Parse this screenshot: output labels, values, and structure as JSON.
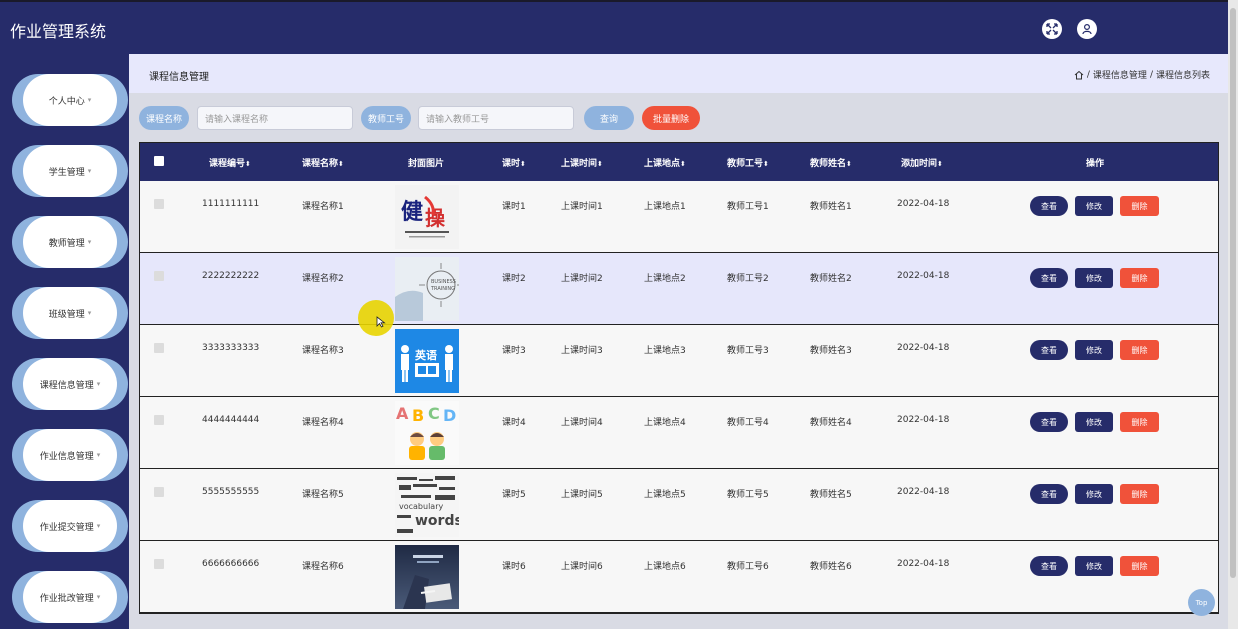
{
  "app": {
    "title": "作业管理系统"
  },
  "topbar": {
    "fullscreen_icon": "fullscreen-icon",
    "user_icon": "user-icon"
  },
  "sidebar": {
    "items": [
      {
        "label": "个人中心"
      },
      {
        "label": "学生管理"
      },
      {
        "label": "教师管理"
      },
      {
        "label": "班级管理"
      },
      {
        "label": "课程信息管理"
      },
      {
        "label": "作业信息管理"
      },
      {
        "label": "作业提交管理"
      },
      {
        "label": "作业批改管理"
      }
    ],
    "caret": "▾"
  },
  "header": {
    "title": "课程信息管理",
    "breadcrumb": [
      "课程信息管理",
      "课程信息列表"
    ],
    "separator": "/"
  },
  "search": {
    "course_name_label": "课程名称",
    "course_name_placeholder": "请输入课程名称",
    "teacher_id_label": "教师工号",
    "teacher_id_placeholder": "请输入教师工号",
    "query_button": "查询",
    "batch_delete_button": "批量删除"
  },
  "table": {
    "columns": [
      "课程编号",
      "课程名称",
      "封面图片",
      "课时",
      "上课时间",
      "上课地点",
      "教师工号",
      "教师姓名",
      "添加时间",
      "操作"
    ],
    "sort_icon": "⬍",
    "actions": {
      "view": "查看",
      "edit": "修改",
      "delete": "删除"
    },
    "rows": [
      {
        "id": "1111111111",
        "name": "课程名称1",
        "cover": "cover-fitness",
        "hours": "课时1",
        "time": "上课时间1",
        "place": "上课地点1",
        "teacher_id": "教师工号1",
        "teacher_name": "教师姓名1",
        "added": "2022-04-18"
      },
      {
        "id": "2222222222",
        "name": "课程名称2",
        "cover": "cover-business-training",
        "hours": "课时2",
        "time": "上课时间2",
        "place": "上课地点2",
        "teacher_id": "教师工号2",
        "teacher_name": "教师姓名2",
        "added": "2022-04-18"
      },
      {
        "id": "3333333333",
        "name": "课程名称3",
        "cover": "cover-english-class",
        "hours": "课时3",
        "time": "上课时间3",
        "place": "上课地点3",
        "teacher_id": "教师工号3",
        "teacher_name": "教师姓名3",
        "added": "2022-04-18"
      },
      {
        "id": "4444444444",
        "name": "课程名称4",
        "cover": "cover-abcd-kids",
        "hours": "课时4",
        "time": "上课时间4",
        "place": "上课地点4",
        "teacher_id": "教师工号4",
        "teacher_name": "教师姓名4",
        "added": "2022-04-18"
      },
      {
        "id": "5555555555",
        "name": "课程名称5",
        "cover": "cover-vocabulary-words",
        "hours": "课时5",
        "time": "上课时间5",
        "place": "上课地点5",
        "teacher_id": "教师工号5",
        "teacher_name": "教师姓名5",
        "added": "2022-04-18"
      },
      {
        "id": "6666666666",
        "name": "课程名称6",
        "cover": "cover-business-reading",
        "hours": "课时6",
        "time": "上课时间6",
        "place": "上课地点6",
        "teacher_id": "教师工号6",
        "teacher_name": "教师姓名6",
        "added": "2022-04-18"
      }
    ]
  },
  "back_to_top": "Top",
  "colors": {
    "primary": "#262c6a",
    "accent": "#8fb3de",
    "danger": "#f0523a",
    "header_bg": "#e7e8fc"
  }
}
